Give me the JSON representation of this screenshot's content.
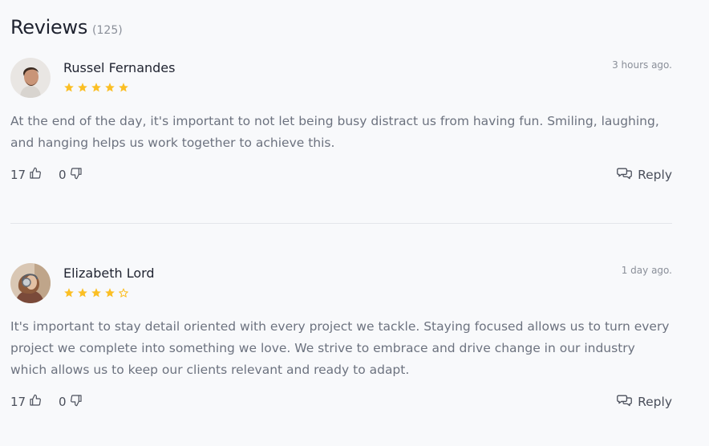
{
  "header": {
    "title": "Reviews",
    "count": "(125)"
  },
  "colors": {
    "star": "#fbbf24",
    "text": "#6c727f",
    "name": "#1f2330"
  },
  "reviews": [
    {
      "name": "Russel Fernandes",
      "time": "3 hours ago.",
      "rating": 5,
      "max_rating": 5,
      "text": "At the end of the day, it's important to not let being busy distract us from having fun. Smiling, laughing, and hanging helps us work together to achieve this.",
      "likes": "17",
      "dislikes": "0",
      "reply_label": "Reply"
    },
    {
      "name": "Elizabeth Lord",
      "time": "1 day ago.",
      "rating": 4,
      "max_rating": 5,
      "text": "It's important to stay detail oriented with every project we tackle. Staying focused allows us to turn every project we complete into something we love. We strive to embrace and drive change in our industry which allows us to keep our clients relevant and ready to adapt.",
      "likes": "17",
      "dislikes": "0",
      "reply_label": "Reply"
    }
  ]
}
